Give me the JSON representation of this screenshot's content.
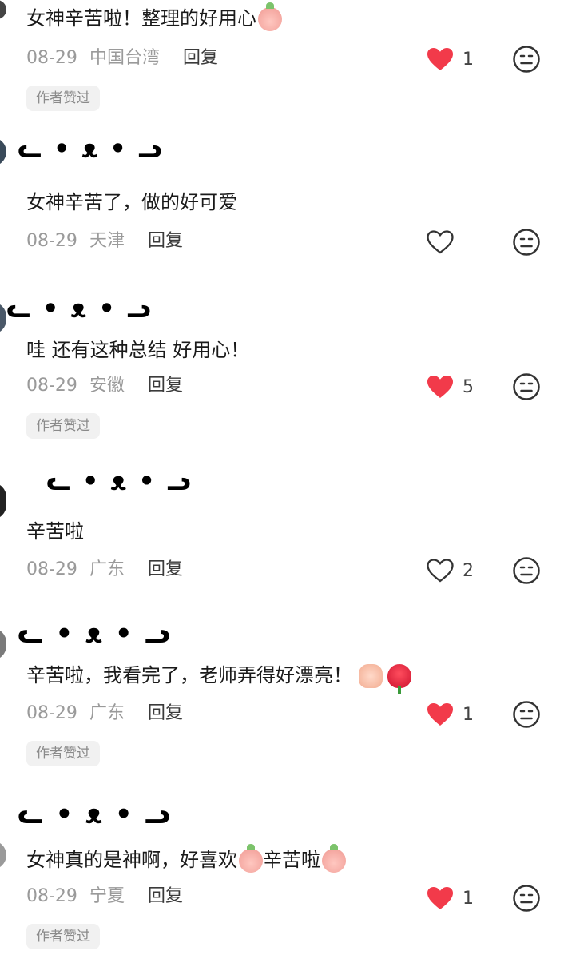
{
  "comments": [
    {
      "username": "",
      "text": "女神辛苦啦！整理的好用心",
      "emoji": "peach-face",
      "date": "08-29",
      "location": "中国台湾",
      "reply": "回复",
      "liked": true,
      "like_count": "1",
      "badge": "作者赞过"
    },
    {
      "username": "ᓚ • ᴥ • ᓗ",
      "text": "女神辛苦了，做的好可爱",
      "date": "08-29",
      "location": "天津",
      "reply": "回复",
      "liked": false,
      "like_count": ""
    },
    {
      "username": "ᓚ • ᴥ • ᓗ",
      "text": "哇 还有这种总结 好用心！",
      "date": "08-29",
      "location": "安徽",
      "reply": "回复",
      "liked": true,
      "like_count": "5",
      "badge": "作者赞过"
    },
    {
      "username": "ᓚ • ᴥ • ᓗ",
      "text": "辛苦啦",
      "date": "08-29",
      "location": "广东",
      "reply": "回复",
      "liked": false,
      "like_count": "2"
    },
    {
      "username": "ᓚ • ᴥ • ᓗ",
      "text": "辛苦啦，我看完了，老师弄得好漂亮！",
      "emojis": [
        "thumbs-up",
        "rose"
      ],
      "date": "08-29",
      "location": "广东",
      "reply": "回复",
      "liked": true,
      "like_count": "1",
      "badge": "作者赞过"
    },
    {
      "username": "ᓚ • ᴥ • ᓗ",
      "text_part1": "女神真的是神啊，好喜欢",
      "text_part2": "辛苦啦",
      "date": "08-29",
      "location": "宁夏",
      "reply": "回复",
      "liked": true,
      "like_count": "1",
      "badge": "作者赞过"
    }
  ],
  "colors": {
    "like_red": "#f23a4a",
    "muted": "#9a9a9a",
    "badge_bg": "#f1f1f1"
  },
  "icons": {
    "like": "heart-icon",
    "dislike": "neutral-face-icon"
  }
}
